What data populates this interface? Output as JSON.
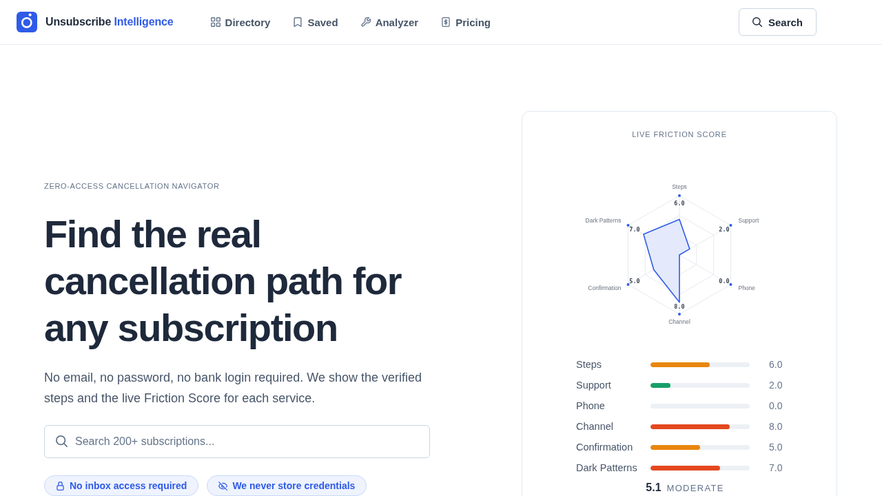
{
  "header": {
    "brand": {
      "name": "Unsubscribe",
      "accent": "Intelligence"
    },
    "nav": [
      {
        "label": "Directory"
      },
      {
        "label": "Saved"
      },
      {
        "label": "Analyzer"
      },
      {
        "label": "Pricing"
      }
    ],
    "search_button": "Search"
  },
  "hero": {
    "eyebrow": "ZERO-ACCESS CANCELLATION NAVIGATOR",
    "title": "Find the real cancellation path for any subscription",
    "description": "No email, no password, no bank login required. We show the verified steps and the live Friction Score for each service.",
    "search": {
      "placeholder": "Search 200+ subscriptions..."
    },
    "badges": [
      "No inbox access required",
      "We never store credentials"
    ]
  },
  "score_card": {
    "title": "LIVE FRICTION SCORE",
    "radar": {
      "axes": [
        {
          "label": "Steps",
          "reading": "6.0"
        },
        {
          "label": "Dark Patterns",
          "reading": "7.0"
        },
        {
          "label": "Support",
          "reading": "2.0"
        },
        {
          "label": "Confirmation",
          "reading": "5.0"
        },
        {
          "label": "Phone",
          "reading": "0.0"
        },
        {
          "label": "Channel",
          "reading": "8.0"
        }
      ]
    },
    "metrics": [
      {
        "name": "Steps",
        "level": 0.6,
        "reading": "6.0",
        "color": "#e8870e"
      },
      {
        "name": "Support",
        "level": 0.2,
        "reading": "2.0",
        "color": "#16a06a"
      },
      {
        "name": "Phone",
        "reading": "0.0"
      },
      {
        "name": "Channel",
        "level": 0.8,
        "reading": "8.0",
        "color": "#e4481f"
      },
      {
        "name": "Confirmation",
        "level": 0.5,
        "reading": "5.0",
        "color": "#e8870e"
      },
      {
        "name": "Dark Patterns",
        "level": 0.7,
        "reading": "7.0",
        "color": "#e4481f"
      }
    ],
    "score": "5.1",
    "rating": "MODERATE"
  }
}
